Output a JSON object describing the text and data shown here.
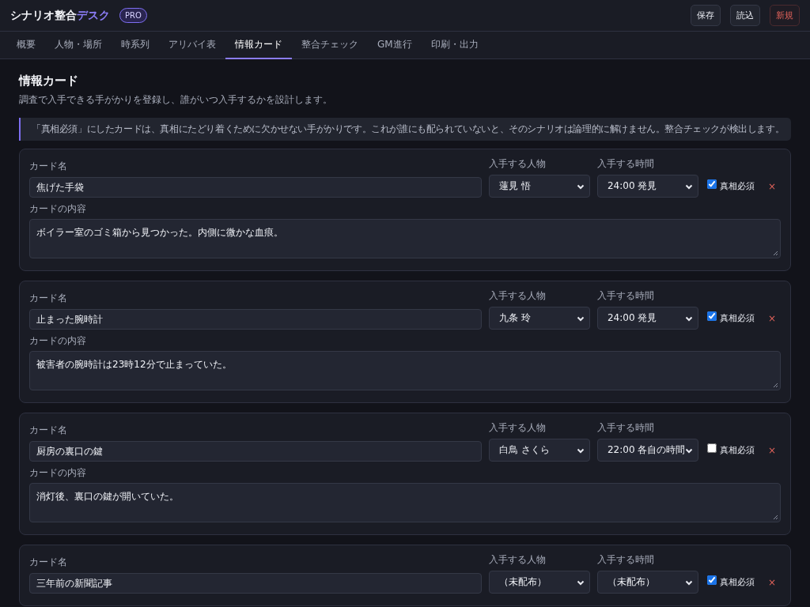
{
  "app": {
    "title": "シナリオ整合",
    "title_accent": "デスク",
    "badge": "PRO"
  },
  "header_buttons": [
    {
      "label": "保存",
      "kind": "normal"
    },
    {
      "label": "読込",
      "kind": "normal"
    },
    {
      "label": "新規",
      "kind": "danger"
    }
  ],
  "tabs": [
    {
      "label": "概要",
      "selected": false
    },
    {
      "label": "人物・場所",
      "selected": false
    },
    {
      "label": "時系列",
      "selected": false
    },
    {
      "label": "アリバイ表",
      "selected": false
    },
    {
      "label": "情報カード",
      "selected": true
    },
    {
      "label": "整合チェック",
      "selected": false
    },
    {
      "label": "GM進行",
      "selected": false
    },
    {
      "label": "印刷・出力",
      "selected": false
    }
  ],
  "page": {
    "heading": "情報カード",
    "description": "調査で入手できる手がかりを登録し、誰がいつ入手するかを設計します。",
    "notice": "「真相必須」にしたカードは、真相にたどり着くために欠かせない手がかりです。これが誰にも配られていないと、そのシナリオは論理的に解けません。整合チェックが検出します。"
  },
  "cards": [
    {
      "name_label": "カード名",
      "name": "焦げた手袋",
      "person_label": "入手する人物",
      "person": "蓮見 悟",
      "time_label": "入手する時間",
      "time": "24:00 発見",
      "required_label": "真相必須",
      "required": true,
      "delete": "×",
      "content_label": "カードの内容",
      "content": "ボイラー室のゴミ箱から見つかった。内側に微かな血痕。"
    },
    {
      "name_label": "カード名",
      "name": "止まった腕時計",
      "person_label": "入手する人物",
      "person": "九条 玲",
      "time_label": "入手する時間",
      "time": "24:00 発見",
      "required_label": "真相必須",
      "required": true,
      "delete": "×",
      "content_label": "カードの内容",
      "content": "被害者の腕時計は23時12分で止まっていた。"
    },
    {
      "name_label": "カード名",
      "name": "厨房の裏口の鍵",
      "person_label": "入手する人物",
      "person": "白鳥 さくら",
      "time_label": "入手する時間",
      "time": "22:00 各自の時間",
      "required_label": "真相必須",
      "required": false,
      "delete": "×",
      "content_label": "カードの内容",
      "content": "消灯後、裏口の鍵が開いていた。"
    },
    {
      "name_label": "カード名",
      "name": "三年前の新聞記事",
      "person_label": "入手する人物",
      "person": "（未配布）",
      "time_label": "入手する時間",
      "time": "（未配布）",
      "required_label": "真相必須",
      "required": true,
      "delete": "×"
    }
  ]
}
